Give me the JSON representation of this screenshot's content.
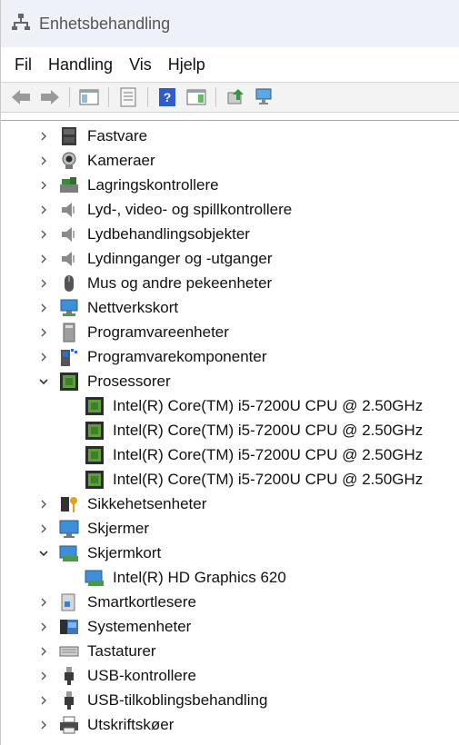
{
  "window": {
    "title": "Enhetsbehandling"
  },
  "menu": {
    "file": "Fil",
    "action": "Handling",
    "view": "Vis",
    "help": "Hjelp"
  },
  "tree": {
    "rows": [
      {
        "label": "Fastvare",
        "icon": "firmware-icon",
        "state": "collapsed",
        "level": 0
      },
      {
        "label": "Kameraer",
        "icon": "camera-icon",
        "state": "collapsed",
        "level": 0
      },
      {
        "label": "Lagringskontrollere",
        "icon": "storage-controller-icon",
        "state": "collapsed",
        "level": 0
      },
      {
        "label": "Lyd-, video- og spillkontrollere",
        "icon": "speaker-icon",
        "state": "collapsed",
        "level": 0
      },
      {
        "label": "Lydbehandlingsobjekter",
        "icon": "speaker-icon",
        "state": "collapsed",
        "level": 0
      },
      {
        "label": "Lydinnganger og -utganger",
        "icon": "speaker-icon",
        "state": "collapsed",
        "level": 0
      },
      {
        "label": "Mus og andre pekeenheter",
        "icon": "mouse-icon",
        "state": "collapsed",
        "level": 0
      },
      {
        "label": "Nettverkskort",
        "icon": "network-adapter-icon",
        "state": "collapsed",
        "level": 0
      },
      {
        "label": "Programvareenheter",
        "icon": "software-device-icon",
        "state": "collapsed",
        "level": 0
      },
      {
        "label": "Programvarekomponenter",
        "icon": "software-component-icon",
        "state": "collapsed",
        "level": 0
      },
      {
        "label": "Prosessorer",
        "icon": "processor-icon",
        "state": "expanded",
        "level": 0
      },
      {
        "label": "Intel(R) Core(TM) i5-7200U CPU @ 2.50GHz",
        "icon": "processor-icon",
        "state": "leaf",
        "level": 1
      },
      {
        "label": "Intel(R) Core(TM) i5-7200U CPU @ 2.50GHz",
        "icon": "processor-icon",
        "state": "leaf",
        "level": 1
      },
      {
        "label": "Intel(R) Core(TM) i5-7200U CPU @ 2.50GHz",
        "icon": "processor-icon",
        "state": "leaf",
        "level": 1
      },
      {
        "label": "Intel(R) Core(TM) i5-7200U CPU @ 2.50GHz",
        "icon": "processor-icon",
        "state": "leaf",
        "level": 1
      },
      {
        "label": "Sikkehetsenheter",
        "icon": "security-device-icon",
        "state": "collapsed",
        "level": 0
      },
      {
        "label": "Skjermer",
        "icon": "monitor-icon",
        "state": "collapsed",
        "level": 0
      },
      {
        "label": "Skjermkort",
        "icon": "display-adapter-icon",
        "state": "expanded",
        "level": 0
      },
      {
        "label": "Intel(R) HD Graphics 620",
        "icon": "display-adapter-icon",
        "state": "leaf",
        "level": 1
      },
      {
        "label": "Smartkortlesere",
        "icon": "smartcard-reader-icon",
        "state": "collapsed",
        "level": 0
      },
      {
        "label": "Systemenheter",
        "icon": "system-device-icon",
        "state": "collapsed",
        "level": 0
      },
      {
        "label": "Tastaturer",
        "icon": "keyboard-icon",
        "state": "collapsed",
        "level": 0
      },
      {
        "label": "USB-kontrollere",
        "icon": "usb-icon",
        "state": "collapsed",
        "level": 0
      },
      {
        "label": "USB-tilkoblingsbehandling",
        "icon": "usb-icon",
        "state": "collapsed",
        "level": 0
      },
      {
        "label": "Utskriftskøer",
        "icon": "printer-icon",
        "state": "collapsed",
        "level": 0
      }
    ]
  },
  "toolbar": {
    "buttons": [
      "back-icon",
      "forward-icon",
      "show-hide-console-tree-icon",
      "properties-icon",
      "help-icon",
      "action-pane-icon",
      "update-driver-icon",
      "scan-hardware-icon"
    ]
  }
}
